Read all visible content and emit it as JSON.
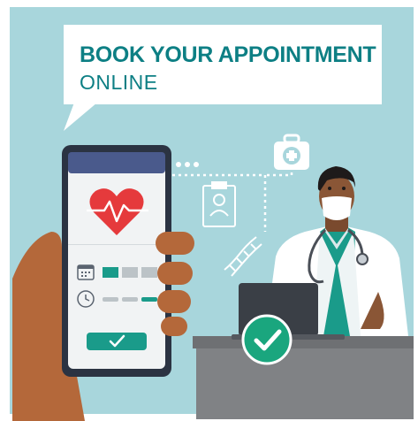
{
  "headline": {
    "title": "BOOK YOUR APPOINTMENT",
    "subtitle": "ONLINE"
  },
  "phone_app": {
    "icons": [
      "heart-rate-icon",
      "calendar-icon",
      "clock-icon",
      "checkmark-icon"
    ],
    "confirm_button_icon": "checkmark-icon"
  },
  "illustration": {
    "elements": [
      "medical-kit-icon",
      "medical-record-icon",
      "dna-icon",
      "doctor",
      "laptop",
      "stethoscope",
      "confirmation-badge"
    ],
    "confirmation_icon": "checkmark-icon"
  },
  "colors": {
    "background": "#a8d6dc",
    "teal": "#1a9b8a",
    "heart_red": "#e53a3c",
    "desk_gray": "#808285",
    "phone_dark": "#2b3342",
    "speech_bubble": "#ffffff",
    "headline_text": "#0d7f84"
  }
}
